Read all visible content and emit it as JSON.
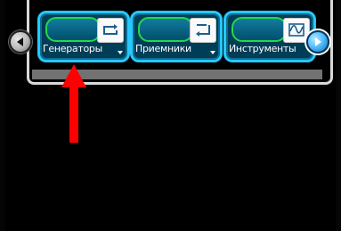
{
  "tabs": [
    {
      "label": "Генераторы",
      "icon": "generator-icon"
    },
    {
      "label": "Приемники",
      "icon": "receiver-icon"
    },
    {
      "label": "Инструменты",
      "icon": "instruments-icon"
    }
  ],
  "navigation": {
    "prev_icon": "arrow-left-icon",
    "next_icon": "arrow-right-icon"
  },
  "colors": {
    "background": "#000000",
    "tile_border": "#27c8ff",
    "tile_fill": "#003d56",
    "pill_border": "#21d94c",
    "annotation_arrow": "#ff0000"
  }
}
